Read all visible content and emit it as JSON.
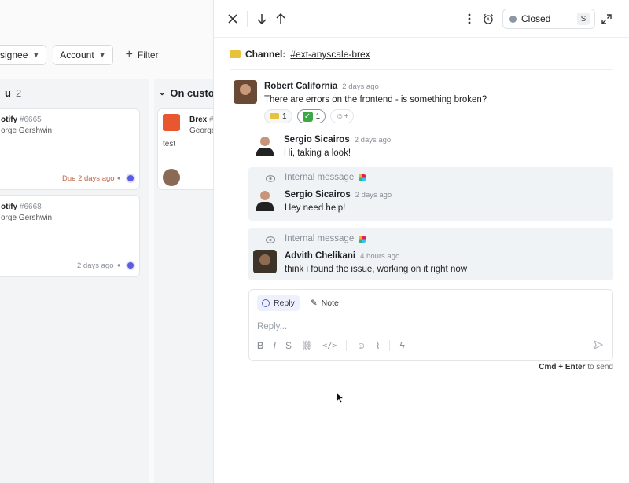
{
  "board": {
    "filters": {
      "assignee_label": "signee",
      "account_label": "Account",
      "filter_label": "Filter"
    },
    "left_column": {
      "title_fragment": "u",
      "count": "2",
      "cards": [
        {
          "title": "otify",
          "number": "#6665",
          "sub": "orge Gershwin",
          "due": "Due 2 days ago"
        },
        {
          "title": "otify",
          "number": "#6668",
          "sub": "orge Gershwin",
          "ago": "2 days ago"
        }
      ]
    },
    "right_column": {
      "title": "On custo",
      "card": {
        "title": "Brex",
        "number": "#",
        "sub": "George",
        "note": "test"
      }
    }
  },
  "pane": {
    "status": {
      "label": "Closed",
      "shortcut": "S"
    },
    "channel": {
      "prefix": "Channel:",
      "name": "#ext-anyscale-brex"
    },
    "messages": [
      {
        "author": "Robert California",
        "time": "2 days ago",
        "text": "There are errors on the frontend - is something broken?",
        "reactions": [
          {
            "count": "1"
          },
          {
            "count": "1"
          }
        ]
      },
      {
        "author": "Sergio Sicairos",
        "time": "2 days ago",
        "text": "Hi, taking a look!"
      },
      {
        "internal_label": "Internal message",
        "author": "Sergio Sicairos",
        "time": "2 days ago",
        "text": "Hey need help!"
      },
      {
        "internal_label": "Internal message",
        "author": "Advith Chelikani",
        "time": "4 hours ago",
        "text": "think i found the issue, working on it right now"
      }
    ],
    "composer": {
      "reply_tab": "Reply",
      "note_tab": "Note",
      "placeholder": "Reply...",
      "hint_keys": "Cmd + Enter",
      "hint_text": "to send"
    }
  },
  "colors": {
    "accent": "#5b5ce2",
    "due": "#c4654a",
    "internal_bg": "#f0f3f6",
    "status_dot": "#8d96a4"
  }
}
